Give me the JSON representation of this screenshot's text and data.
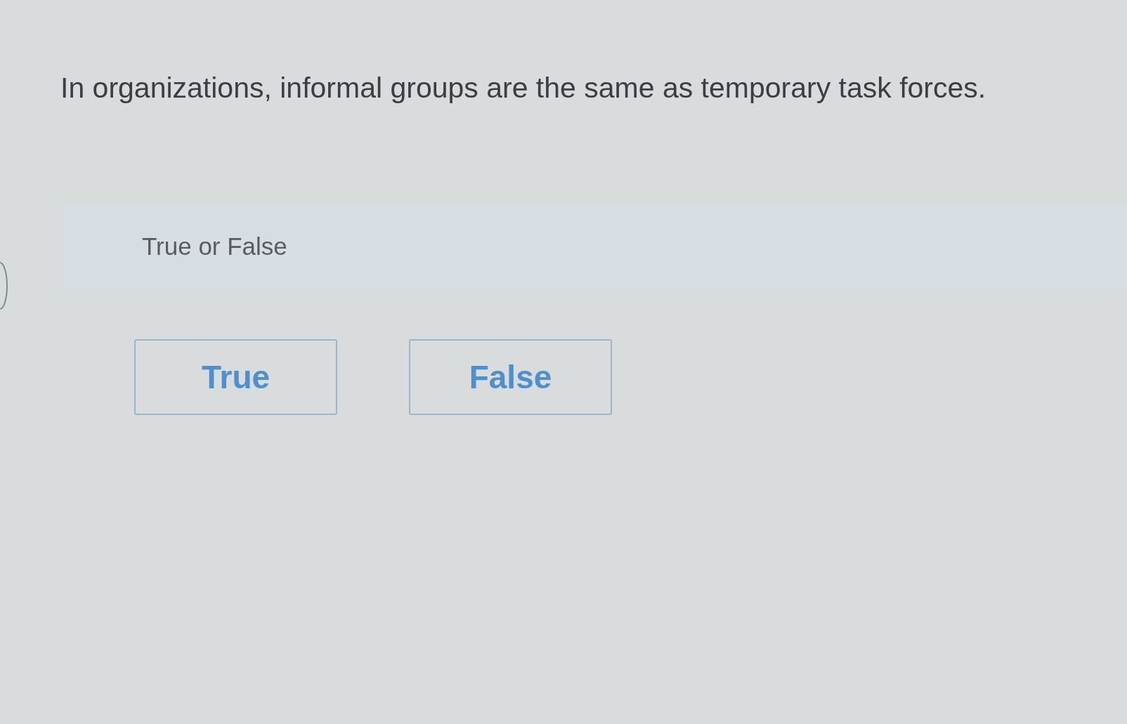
{
  "question": {
    "text": "In organizations, informal groups are the same as temporary task forces."
  },
  "prompt": {
    "text": "True or False"
  },
  "options": [
    {
      "label": "True",
      "selected": false
    },
    {
      "label": "False",
      "selected": false
    }
  ]
}
